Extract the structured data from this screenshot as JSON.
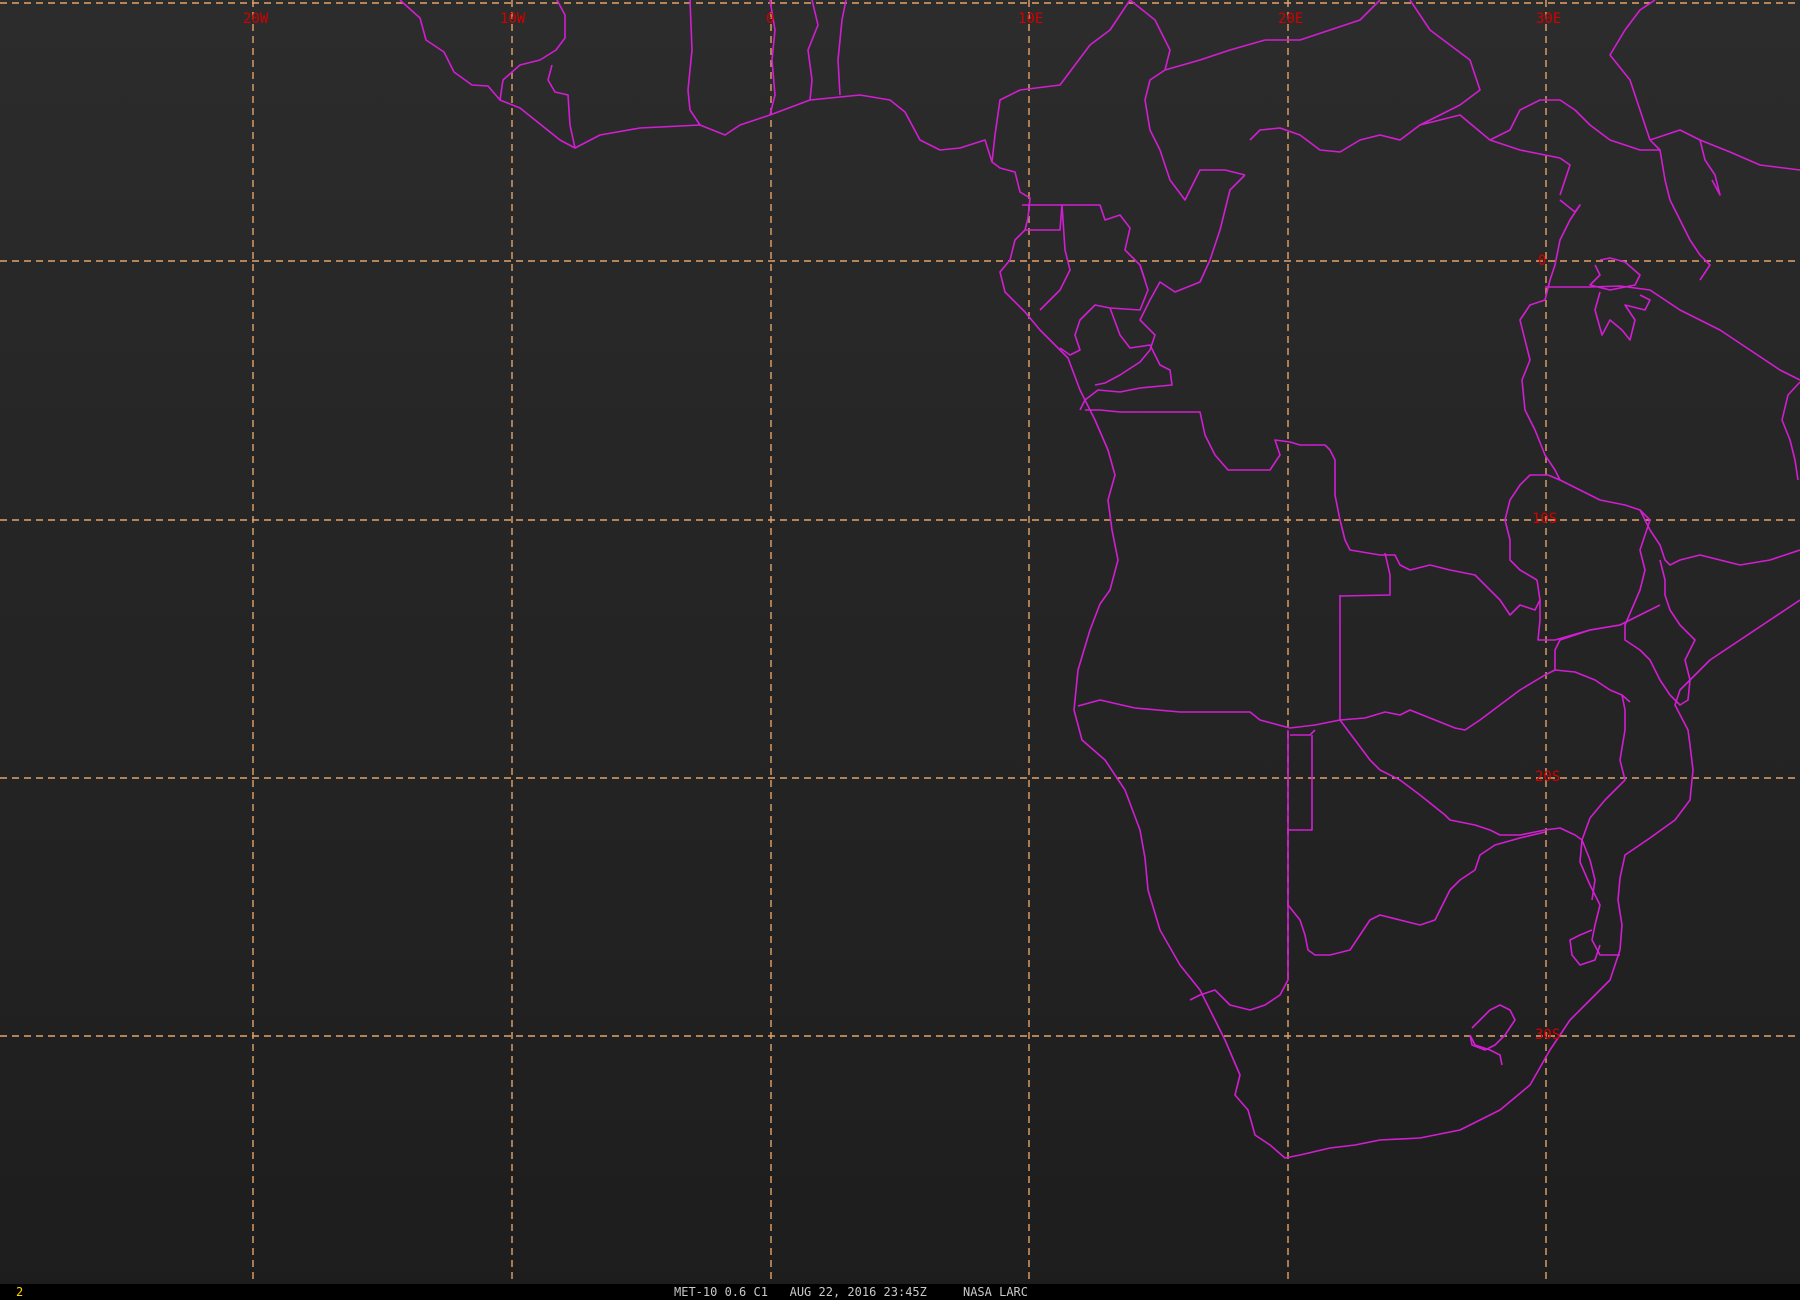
{
  "map": {
    "title": "MET-10 0.6 C1   AUG 22, 2016 23:45Z     NASA LARC",
    "frame_number": "2",
    "colors": {
      "grid": "#e3a36a",
      "borders": "#d21ed2",
      "labels": "#d40000",
      "frame_number": "#ffd400"
    },
    "longitude_labels": [
      "20W",
      "10W",
      "0",
      "10E",
      "20E",
      "30E"
    ],
    "latitude_labels": [
      "0",
      "10S",
      "20S",
      "30S"
    ]
  }
}
